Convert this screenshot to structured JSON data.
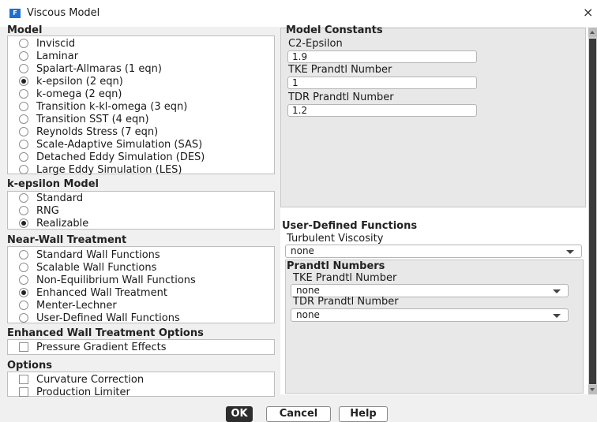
{
  "window": {
    "title": "Viscous Model",
    "app_icon_letter": "F",
    "close_glyph": "×"
  },
  "model": {
    "label": "Model",
    "options": [
      {
        "label": "Inviscid",
        "selected": false
      },
      {
        "label": "Laminar",
        "selected": false
      },
      {
        "label": "Spalart-Allmaras (1 eqn)",
        "selected": false
      },
      {
        "label": "k-epsilon (2 eqn)",
        "selected": true
      },
      {
        "label": "k-omega (2 eqn)",
        "selected": false
      },
      {
        "label": "Transition k-kl-omega (3 eqn)",
        "selected": false
      },
      {
        "label": "Transition SST (4 eqn)",
        "selected": false
      },
      {
        "label": "Reynolds Stress (7 eqn)",
        "selected": false
      },
      {
        "label": "Scale-Adaptive Simulation (SAS)",
        "selected": false
      },
      {
        "label": "Detached Eddy Simulation (DES)",
        "selected": false
      },
      {
        "label": "Large Eddy Simulation (LES)",
        "selected": false
      }
    ]
  },
  "k_epsilon_model": {
    "label": "k-epsilon Model",
    "options": [
      {
        "label": "Standard",
        "selected": false
      },
      {
        "label": "RNG",
        "selected": false
      },
      {
        "label": "Realizable",
        "selected": true
      }
    ]
  },
  "near_wall": {
    "label": "Near-Wall Treatment",
    "options": [
      {
        "label": "Standard Wall Functions",
        "selected": false
      },
      {
        "label": "Scalable Wall Functions",
        "selected": false
      },
      {
        "label": "Non-Equilibrium Wall Functions",
        "selected": false
      },
      {
        "label": "Enhanced Wall Treatment",
        "selected": true
      },
      {
        "label": "Menter-Lechner",
        "selected": false
      },
      {
        "label": "User-Defined Wall Functions",
        "selected": false
      }
    ]
  },
  "enhanced_options": {
    "label": "Enhanced Wall Treatment Options",
    "options": [
      {
        "label": "Pressure Gradient Effects",
        "checked": false
      }
    ]
  },
  "options": {
    "label": "Options",
    "options": [
      {
        "label": "Curvature Correction",
        "checked": false
      },
      {
        "label": "Production Limiter",
        "checked": false
      }
    ]
  },
  "model_constants": {
    "label": "Model Constants",
    "fields": [
      {
        "label": "C2-Epsilon",
        "value": "1.9"
      },
      {
        "label": "TKE Prandtl Number",
        "value": "1"
      },
      {
        "label": "TDR Prandtl Number",
        "value": "1.2"
      }
    ]
  },
  "udf": {
    "label": "User-Defined Functions",
    "turbulent_viscosity_label": "Turbulent Viscosity",
    "turbulent_viscosity_value": "none",
    "prandtl_label": "Prandtl Numbers",
    "tke_label": "TKE Prandtl Number",
    "tke_value": "none",
    "tdr_label": "TDR Prandtl Number",
    "tdr_value": "none"
  },
  "buttons": {
    "ok": "OK",
    "cancel": "Cancel",
    "help": "Help"
  }
}
